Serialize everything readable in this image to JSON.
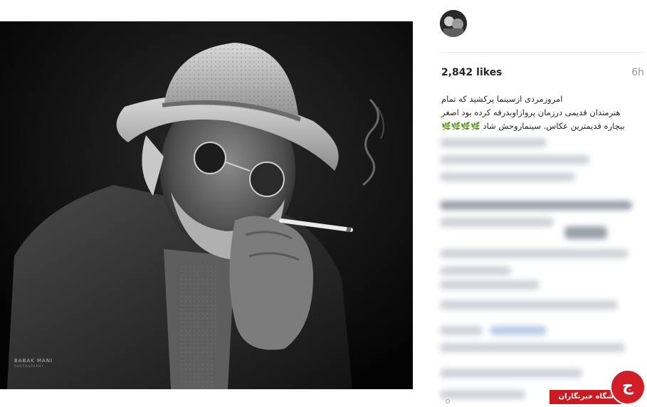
{
  "post": {
    "image_alt": "Black and white portrait of an elderly man in a white hat and round glasses holding a cigarette",
    "watermark_name": "BABAK MANI",
    "watermark_sub": "PHOTOGRAPHY"
  },
  "header": {
    "avatar": "profile-avatar"
  },
  "stats": {
    "likes": "2,842 likes",
    "time": "6h"
  },
  "caption": {
    "line1": "امروزمردی ازسینما پرکشید که تمام",
    "line2": "هنرمندان قدیمی درزمان پروازاوبدرقه کرده بود اصغر",
    "line3": "بیچاره قدیمترین عکاس. سینماروحش شاد",
    "sprouts": "🌿🌿🌿🌿"
  },
  "badge": {
    "label": "باشگاه خبرنگاران",
    "logo_char": "ج"
  }
}
